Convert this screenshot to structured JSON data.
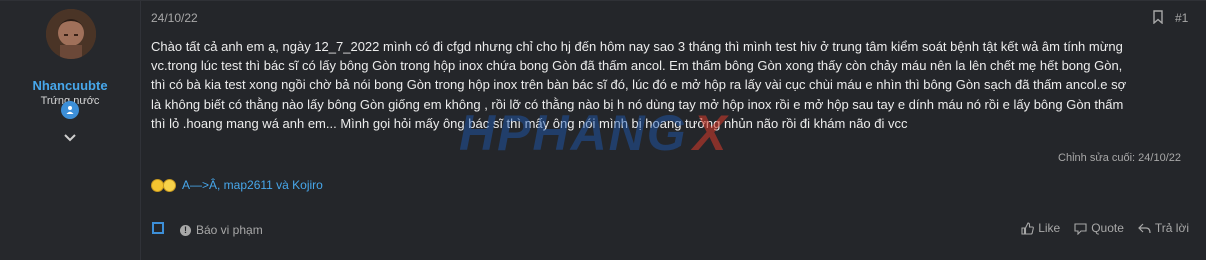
{
  "user": {
    "name": "Nhancuubte",
    "title": "Trứng nước"
  },
  "post": {
    "date": "24/10/22",
    "number": "#1",
    "lines": [
      "Chào tất cả anh em ạ, ngày 12_7_2022 mình có đi cfgd nhưng chỉ cho hj đến hôm nay sao 3 tháng thì mình test hiv ở trung tâm kiểm soát bệnh tật kết wả âm tính mừng",
      "vc.trong lúc test thì bác sĩ có lấy bông Gòn trong hộp inox chứa bong Gòn đã thấm ancol. Em thấm bông Gòn xong thấy còn chảy máu nên la lên chết mẹ hết bong Gòn,",
      "thì có bà kia test xong ngồi chờ bả nói bong Gòn trong hộp inox trên bàn bác sĩ đó, lúc đó e mở hộp ra lấy vài cục chùi máu e nhìn thì bông Gòn sạch đã thấm ancol.e sợ",
      "là không biết có thằng nào lấy bông Gòn giống em không , rồi lỡ có thằng nào bị h nó dùng tay mở hộp inox rồi e mở hộp sau tay e dính máu nó rồi e lấy bông Gòn thấm",
      "thì lỏ .hoang mang wá anh em... Mình gọi hỏi mấy ông bác sĩ thì mấy ông nói mình bị hoang tưởng nhủn não rồi đi khám não đi vcc"
    ],
    "edited": "Chỉnh sửa cuối: 24/10/22",
    "watermark": "HPHANGX"
  },
  "reactions": {
    "text": "A—>Â, map2611 và Kojiro"
  },
  "footer": {
    "report": "Báo vi phạm",
    "like": "Like",
    "quote": "Quote",
    "reply": "Trả lời"
  },
  "colors": {
    "background": "#24262a",
    "accent": "#47a7eb",
    "text": "#ececec",
    "muted": "#a8a8a8"
  },
  "icons": {
    "bookmark": "bookmark-icon",
    "expand": "chevron-down-icon",
    "badge": "user-badge-icon",
    "report": "info-icon",
    "like": "thumbs-up-icon",
    "quote": "quote-icon",
    "reply": "reply-icon"
  }
}
